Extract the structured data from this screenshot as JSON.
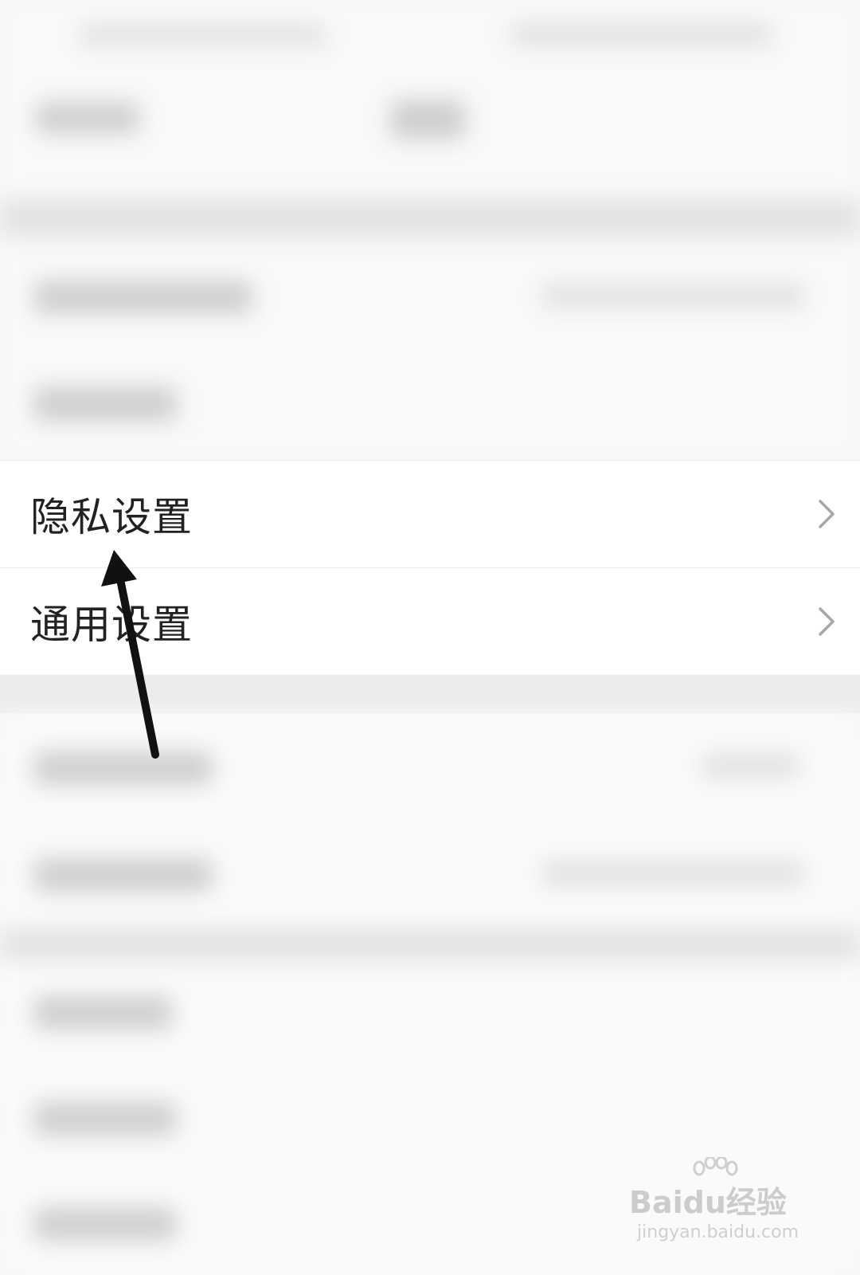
{
  "settings": {
    "items": [
      {
        "label": "隐私设置"
      },
      {
        "label": "通用设置"
      }
    ]
  },
  "watermark": {
    "brand": "Baidu经验",
    "url": "jingyan.baidu.com"
  },
  "colors": {
    "background": "#f7f7f7",
    "card": "#ffffff",
    "text": "#222222",
    "chevron": "#a8a8a8",
    "arrow": "#111111"
  }
}
